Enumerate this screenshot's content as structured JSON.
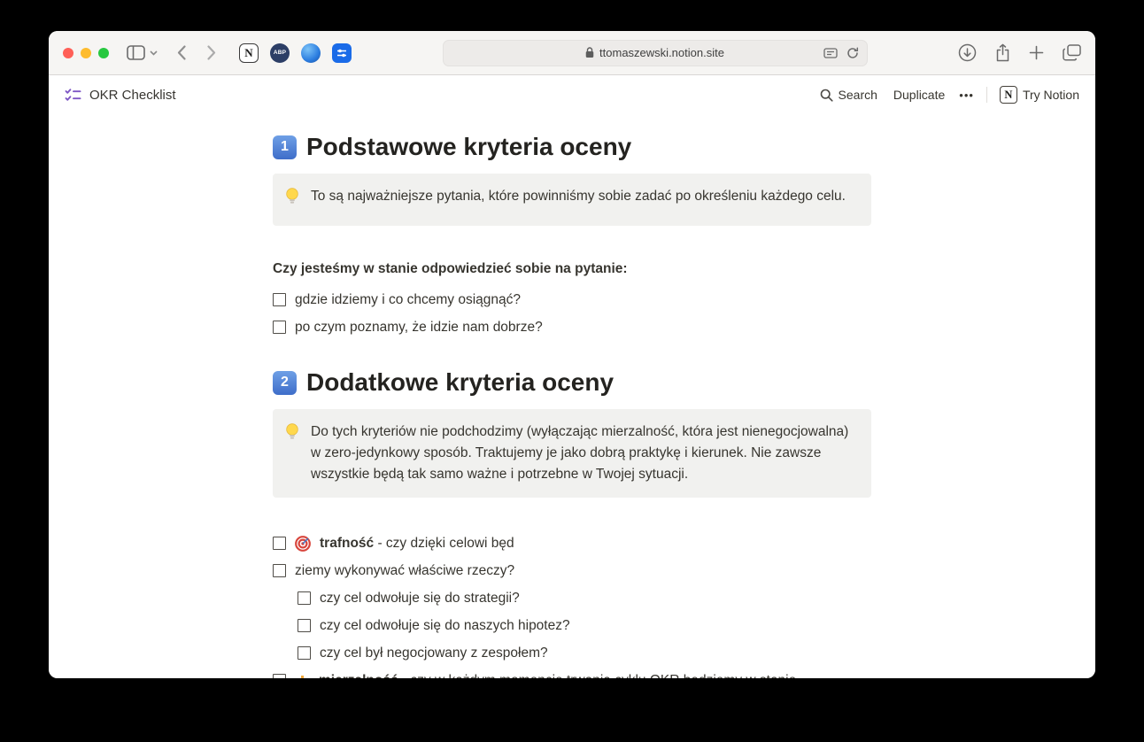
{
  "browser": {
    "url": "ttomaszewski.notion.site",
    "abp_label": "ABP",
    "notion_ext_letter": "N"
  },
  "site_header": {
    "title": "OKR Checklist",
    "search": "Search",
    "duplicate": "Duplicate",
    "more": "•••",
    "notion_logo_letter": "N",
    "try_notion": "Try Notion"
  },
  "content": {
    "s1": {
      "keycap": "1",
      "title": "Podstawowe kryteria oceny",
      "callout": "To są najważniejsze pytania, które powinniśmy sobie zadać po określeniu każdego celu.",
      "question": "Czy jesteśmy w stanie odpowiedzieć sobie na pytanie:",
      "todos": [
        {
          "text": "gdzie idziemy i co chcemy osiągnąć?"
        },
        {
          "text": "po czym poznamy, że idzie nam dobrze?"
        }
      ]
    },
    "s2": {
      "keycap": "2",
      "title": "Dodatkowe kryteria oceny",
      "callout": "Do tych kryteriów nie podchodzimy (wyłączając mierzalność, która jest nienegocjowalna) w zero-jedynkowy sposób. Traktujemy je jako dobrą praktykę i kierunek. Nie zawsze wszystkie będą tak samo ważne i potrzebne w Twojej sytuacji.",
      "todos": [
        {
          "bold": "trafność",
          "text": " - czy dzięki celowi będ"
        },
        {
          "bold": "",
          "text": "ziemy wykonywać właściwe rzeczy?"
        },
        {
          "bold": "",
          "text": "czy cel odwołuje się do strategii?"
        },
        {
          "bold": "",
          "text": "czy cel odwołuje się do naszych hipotez?"
        },
        {
          "bold": "",
          "text": "czy cel był negocjowany z zespołem?"
        },
        {
          "bold": "mierzalność",
          "text": " - czy w każdym momencie trwania cyklu OKR będziemy w stanie"
        }
      ]
    },
    "colors": {
      "accent_keycap": "#4e7ddb",
      "callout_bg": "#f1f1ef",
      "text": "#37352f"
    }
  }
}
